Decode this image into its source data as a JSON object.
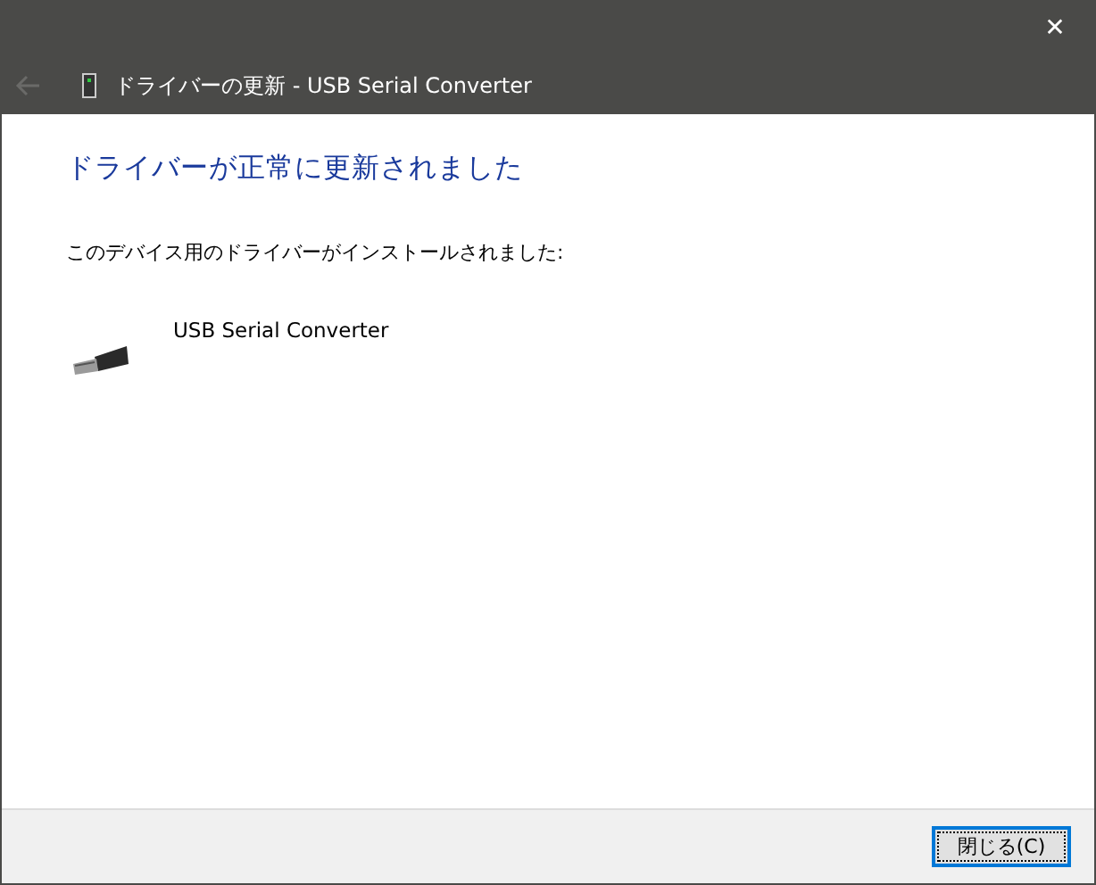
{
  "window": {
    "title": "ドライバーの更新 - USB Serial Converter",
    "close": "✕",
    "back_disabled": true
  },
  "heading": "ドライバーが正常に更新されました",
  "message": "このデバイス用のドライバーがインストールされました:",
  "device": {
    "name": "USB Serial Converter"
  },
  "buttons": [
    {
      "label": "閉じる(C)",
      "focused": true
    }
  ]
}
